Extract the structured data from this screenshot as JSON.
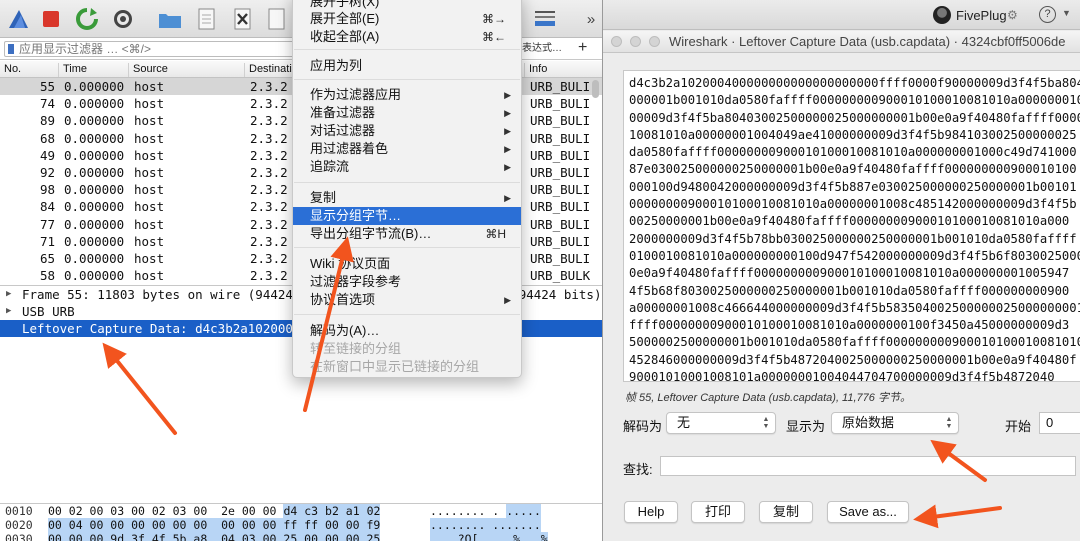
{
  "main_window": {
    "filter": {
      "placeholder": "应用显示过滤器 … <⌘/>",
      "expression_button": "表达式…",
      "add_button": "+"
    },
    "columns": [
      "No.",
      "Time",
      "Source",
      "Destinati",
      "Info"
    ],
    "packets": [
      {
        "no": "55",
        "time": "0.000000",
        "src": "host",
        "dst": "2.3.2",
        "info": "URB_BULI",
        "selected": true
      },
      {
        "no": "74",
        "time": "0.000000",
        "src": "host",
        "dst": "2.3.2",
        "info": "URB_BULI"
      },
      {
        "no": "89",
        "time": "0.000000",
        "src": "host",
        "dst": "2.3.2",
        "info": "URB_BULI"
      },
      {
        "no": "68",
        "time": "0.000000",
        "src": "host",
        "dst": "2.3.2",
        "info": "URB_BULI"
      },
      {
        "no": "49",
        "time": "0.000000",
        "src": "host",
        "dst": "2.3.2",
        "info": "URB_BULI"
      },
      {
        "no": "92",
        "time": "0.000000",
        "src": "host",
        "dst": "2.3.2",
        "info": "URB_BULI"
      },
      {
        "no": "98",
        "time": "0.000000",
        "src": "host",
        "dst": "2.3.2",
        "info": "URB_BULI"
      },
      {
        "no": "84",
        "time": "0.000000",
        "src": "host",
        "dst": "2.3.2",
        "info": "URB_BULI"
      },
      {
        "no": "77",
        "time": "0.000000",
        "src": "host",
        "dst": "2.3.2",
        "info": "URB_BULI"
      },
      {
        "no": "71",
        "time": "0.000000",
        "src": "host",
        "dst": "2.3.2",
        "info": "URB_BULI"
      },
      {
        "no": "65",
        "time": "0.000000",
        "src": "host",
        "dst": "2.3.2",
        "info": "URB_BULI"
      },
      {
        "no": "58",
        "time": "0.000000",
        "src": "host",
        "dst": "2.3.2",
        "info": "URB_BULK"
      }
    ],
    "details": [
      {
        "label": "Frame 55: 11803 bytes on wire (94424 bits), 11803 bytes captured (94424 bits)",
        "expandable": true
      },
      {
        "label": "USB URB",
        "expandable": true
      },
      {
        "label": "Leftover Capture Data: d4c3b2a1020004000000000000000000000000...",
        "expandable": false,
        "selected": true
      }
    ],
    "bytes": [
      {
        "offset": "0010",
        "hex_plain": "00 02 00 03 00 02 03 00  2e 00 00",
        "hex_hl": "d4 c3 b2 a1 02",
        "ascii": "........ .",
        "ascii_hl": "....."
      },
      {
        "offset": "0020",
        "hex_plain": "",
        "hex_hl": "00 04 00 00 00 00 00 00  00 00 00 ff ff 00 00 f9",
        "ascii": "",
        "ascii_hl": "........ ......."
      },
      {
        "offset": "0030",
        "hex_plain": "",
        "hex_hl": "00 00 00 9d 3f 4f 5b a8  04 03 00 25 00 00 00 25",
        "ascii": "",
        "ascii_hl": "....?O[. ...%...%"
      }
    ]
  },
  "context_menu": {
    "items": [
      {
        "label": "展开子树(X)",
        "disabled": false
      },
      {
        "label": "展开全部(E)",
        "shortcut": "⌘→"
      },
      {
        "label": "收起全部(A)",
        "shortcut": "⌘←"
      },
      {
        "label": "应用为列"
      },
      {
        "label": "作为过滤器应用",
        "submenu": true
      },
      {
        "label": "准备过滤器",
        "submenu": true
      },
      {
        "label": "对话过滤器",
        "submenu": true
      },
      {
        "label": "用过滤器着色",
        "submenu": true
      },
      {
        "label": "追踪流",
        "submenu": true
      },
      {
        "label": "复制",
        "submenu": true
      },
      {
        "label": "显示分组字节…",
        "highlighted": true
      },
      {
        "label": "导出分组字节流(B)…",
        "shortcut": "⌘H"
      },
      {
        "label": "Wiki 协议页面"
      },
      {
        "label": "过滤器字段参考"
      },
      {
        "label": "协议首选项",
        "submenu": true
      },
      {
        "label": "解码为(A)…"
      },
      {
        "label": "转至链接的分组",
        "disabled": true
      },
      {
        "label": "在新窗口中显示已链接的分组",
        "disabled": true
      }
    ]
  },
  "top_strip": {
    "profile_name": "FivePlug",
    "help_glyph": "?",
    "more_glyph": "»"
  },
  "dialog": {
    "title": "Wireshark · Leftover Capture Data (usb.capdata) · 4324cbf0ff5006de",
    "hex_lines": [
      "d4c3b2a102000400000000000000000000ffff0000f90000009d3f4f5ba8040",
      "000001b001010da0580faffff000000000900010100010081010a000000010",
      "00009d3f4f5ba80403002500000025000000001b00e0a9f40480faffff00000",
      "10081010a00000001004049ae41000000009d3f4f5b984103002500000025",
      "da0580faffff00000000900010100010081010a000000001000c49d741000",
      "87e030025000000250000001b00e0a9f40480faffff000000000900010100",
      "000100d9480042000000009d3f4f5b887e030025000000250000001b00101",
      "00000000900010100010081010a00000001008c485142000000009d3f4f5b",
      "00250000001b00e0a9f40480faffff00000000900010100010081010a000",
      "2000000009d3f4f5b78bb030025000000250000001b001010da0580faffff",
      "0100010081010a000000000100d947f542000000009d3f4f5b6f8030025000",
      "0e0a9f40480faffff000000000900010100010081010a000000001005947",
      "4f5b68f8030025000000250000001b001010da0580faffff000000000900",
      "a00000001008c466644000000009d3f4f5b583504002500000025000000001",
      "ffff00000000900010100010081010a0000000100f3450a45000000009d3",
      "5000002500000001b001010da0580faffff000000000900010100010081010",
      "452846000000009d3f4f5b4872040025000000250000001b00e0a9f40480f",
      "90001010001008101a00000001004044704700000009d3f4f5b4872040",
      "001b001010da0580faffff00000000900010100010081010a0000000100",
      "d3f4f5b38af0400250000002500000001b00e0a9f40480faffff00000000"
    ],
    "frame_info": "帧 55, Leftover Capture Data (usb.capdata), 11,776 字节。",
    "decode_label": "解码为",
    "decode_value": "无",
    "show_label": "显示为",
    "show_value": "原始数据",
    "start_label": "开始",
    "start_value": "0",
    "find_label": "查找:",
    "find_value": "",
    "buttons": {
      "help": "Help",
      "print": "打印",
      "copy": "复制",
      "save_as": "Save as..."
    }
  },
  "colors": {
    "selection_blue": "#1a5fc7",
    "menu_highlight": "#2b6fd6",
    "arrow_red": "#f2541e",
    "bytes_highlight": "#b8d5f5"
  }
}
